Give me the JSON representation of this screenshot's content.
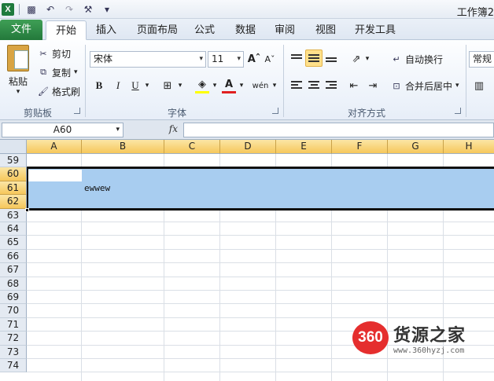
{
  "window": {
    "title": "工作簿2"
  },
  "tabs": [
    "文件",
    "开始",
    "插入",
    "页面布局",
    "公式",
    "数据",
    "审阅",
    "视图",
    "开发工具"
  ],
  "ribbon": {
    "clipboard": {
      "paste": "粘贴",
      "cut": "剪切",
      "copy": "复制",
      "format_painter": "格式刷",
      "group_label": "剪贴板"
    },
    "font": {
      "name": "宋体",
      "size": "11",
      "bold": "B",
      "italic": "I",
      "underline": "U",
      "group_label": "字体",
      "phonetic": "wén"
    },
    "alignment": {
      "wrap_text": "自动换行",
      "merge_center": "合并后居中",
      "group_label": "对齐方式"
    },
    "number": {
      "format": "常规"
    }
  },
  "formula_bar": {
    "name_box": "A60",
    "fx": "fx",
    "content": ""
  },
  "sheet": {
    "columns": [
      "A",
      "B",
      "C",
      "D",
      "E",
      "F",
      "G",
      "H"
    ],
    "rows": [
      "59",
      "60",
      "61",
      "62",
      "63",
      "64",
      "65",
      "66",
      "67",
      "68",
      "69",
      "70",
      "71",
      "72",
      "73",
      "74"
    ],
    "selected_rows": [
      "60",
      "61",
      "62"
    ],
    "cells": {
      "B61": "ewwew"
    }
  },
  "watermark": {
    "badge": "360",
    "title": "货源之家",
    "url": "www.360hyzj.com"
  },
  "colors": {
    "selection": "#a8cdf0",
    "file_tab": "#2d8a46",
    "header_highlight": "#f6c75b"
  }
}
